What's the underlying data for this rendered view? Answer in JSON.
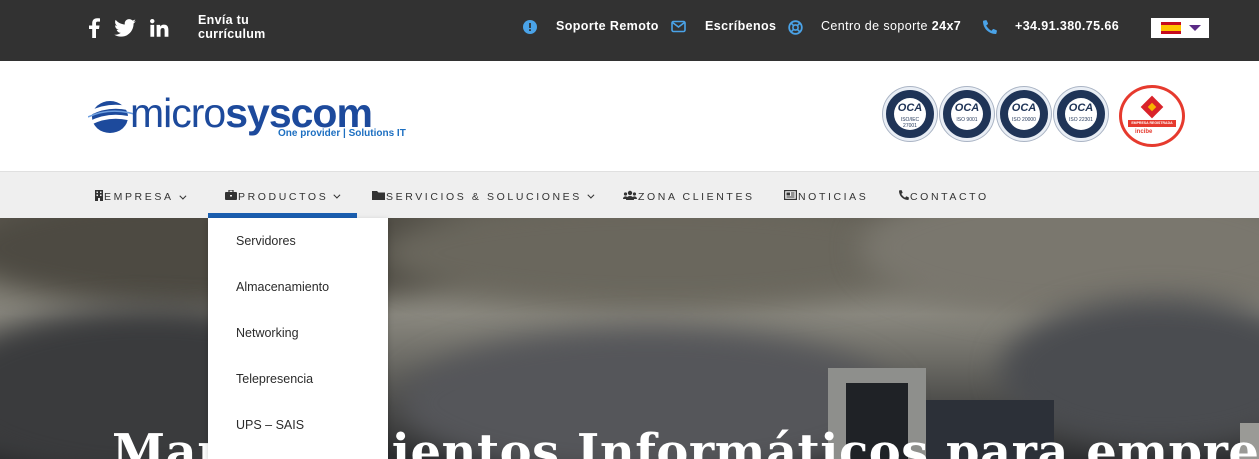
{
  "topbar": {
    "social_icons": [
      "facebook-icon",
      "twitter-icon",
      "linkedin-icon"
    ],
    "cv_link": "Envía tu currículum",
    "support_remote": "Soporte Remoto",
    "write_us": "Escríbenos",
    "support_center_prefix": "Centro de soporte ",
    "support_center_hours": "24x7",
    "phone": "+34.91.380.75.66",
    "language": "es",
    "colors": {
      "background": "#323232",
      "icon_accent": "#4aa3e8"
    }
  },
  "header": {
    "logo_prefix": "micro",
    "logo_brand": "syscom",
    "logo_tagline": "One provider | Solutions IT",
    "certifications": [
      {
        "org": "OCA",
        "standard": "ISO/IEC 27001"
      },
      {
        "org": "OCA",
        "standard": "ISO 9001"
      },
      {
        "org": "OCA",
        "standard": "ISO 20000"
      },
      {
        "org": "OCA",
        "standard": "ISO 22301"
      }
    ],
    "seal_band": "EMPRESA REGISTRADA",
    "seal_brand": "incibe"
  },
  "nav": {
    "items": [
      {
        "label": "EMPRESA",
        "icon": "building-icon",
        "dropdown": true
      },
      {
        "label": "PRODUCTOS",
        "icon": "briefcase-icon",
        "dropdown": true,
        "active": true
      },
      {
        "label": "SERVICIOS & SOLUCIONES",
        "icon": "folder-icon",
        "dropdown": true
      },
      {
        "label": "ZONA CLIENTES",
        "icon": "users-icon",
        "dropdown": false
      },
      {
        "label": "NOTICIAS",
        "icon": "newspaper-icon",
        "dropdown": false
      },
      {
        "label": "CONTACTO",
        "icon": "phone-icon",
        "dropdown": false
      }
    ],
    "active_color": "#1b5fb0"
  },
  "dropdown": {
    "items": [
      "Servidores",
      "Almacenamiento",
      "Networking",
      "Telepresencia",
      "UPS – SAIS"
    ]
  },
  "hero": {
    "title": "Mantenimientos Informáticos para empresas"
  }
}
